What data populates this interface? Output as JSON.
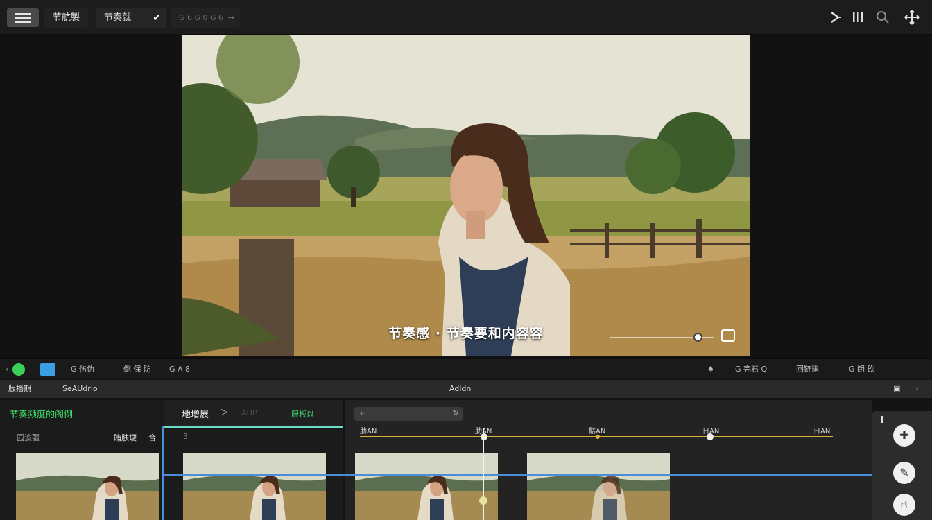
{
  "topbar": {
    "tabs": [
      {
        "label": "节航製"
      },
      {
        "label": "节奏就"
      },
      {
        "label": "G 6 G 0 G 6"
      }
    ],
    "check_glyph": "✔",
    "arrow_glyph": "→",
    "right_icons": [
      "split-icon",
      "bars-icon",
      "zoom-icon",
      "move-icon"
    ]
  },
  "viewer": {
    "subtitle": "节奏感 · 节奏要和内容容"
  },
  "toolbar": {
    "left_items": [
      "G 伤伪",
      "倒 保 防",
      "G A 8"
    ],
    "right_items": [
      "G 完石 Q",
      "回链建",
      "G 钥 砍"
    ]
  },
  "strip": {
    "left": "版播期",
    "middle": "SeAUdrio",
    "center": "Adldn"
  },
  "leftpanel": {
    "title": "节奏频度的阁例",
    "tab_main": "地增展",
    "tab_muted": "ADP",
    "tab_green": "服板以",
    "sub_left": "园波疆",
    "sub_right": "賄肤埂",
    "sub_glyph": "合",
    "sub_mark": "3"
  },
  "timeline": {
    "search": "←",
    "ruler": [
      "肋AN",
      "肋AN",
      "骷AN",
      "日AN",
      "日AN"
    ]
  },
  "colors": {
    "accent_green": "#3fe06a",
    "accent_blue": "#4b8ed8",
    "keyframe_yellow": "#d7b53a"
  }
}
